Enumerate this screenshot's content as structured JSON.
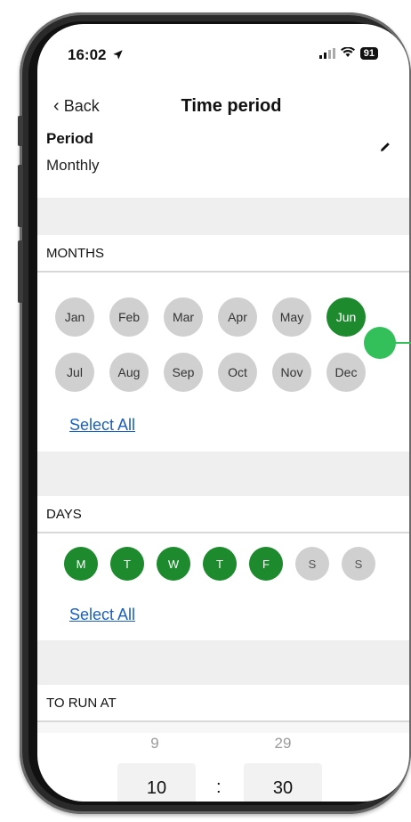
{
  "status": {
    "time": "16:02",
    "location_icon": "navigation-arrow-icon",
    "battery": "91"
  },
  "nav": {
    "back_label": "Back",
    "title": "Time period"
  },
  "period": {
    "label": "Period",
    "value": "Monthly",
    "edit_icon": "pencil-icon"
  },
  "months": {
    "header": "MONTHS",
    "items": [
      {
        "label": "Jan",
        "selected": false
      },
      {
        "label": "Feb",
        "selected": false
      },
      {
        "label": "Mar",
        "selected": false
      },
      {
        "label": "Apr",
        "selected": false
      },
      {
        "label": "May",
        "selected": false
      },
      {
        "label": "Jun",
        "selected": true
      },
      {
        "label": "Jul",
        "selected": false
      },
      {
        "label": "Aug",
        "selected": false
      },
      {
        "label": "Sep",
        "selected": false
      },
      {
        "label": "Oct",
        "selected": false
      },
      {
        "label": "Nov",
        "selected": false
      },
      {
        "label": "Dec",
        "selected": false
      }
    ],
    "select_all": "Select All"
  },
  "days": {
    "header": "DAYS",
    "items": [
      {
        "label": "M",
        "selected": true
      },
      {
        "label": "T",
        "selected": true
      },
      {
        "label": "W",
        "selected": true
      },
      {
        "label": "T",
        "selected": true
      },
      {
        "label": "F",
        "selected": true
      },
      {
        "label": "S",
        "selected": false
      },
      {
        "label": "S",
        "selected": false
      }
    ],
    "select_all": "Select All"
  },
  "run_at": {
    "header": "TO RUN AT",
    "hour_prev": "9",
    "minute_prev": "29",
    "hour": "10",
    "minute": "30",
    "separator": ":"
  },
  "colors": {
    "accent": "#1e8a2e",
    "link": "#1a5fc4",
    "pointer": "#33c05a"
  }
}
